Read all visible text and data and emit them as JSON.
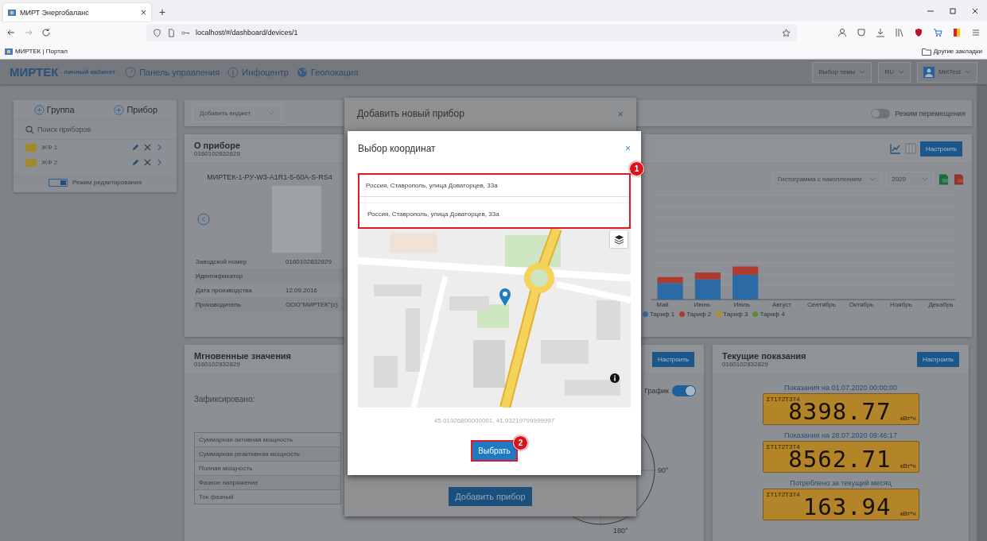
{
  "browser": {
    "tab": {
      "title": "МИРТ Энергобаланс",
      "close": "×"
    },
    "new_tab": "+",
    "url": "localhost/#/dashboard/devices/1",
    "bookmarks": [
      "МИРТЕК | Портал"
    ],
    "other_bookmarks": "Другие закладки"
  },
  "header": {
    "logo": "МИРТЕК",
    "logo_sub": "- личный кабинет",
    "nav": [
      {
        "label": "Панель управления",
        "kind": "gauge"
      },
      {
        "label": "Инфоцентр",
        "kind": "info"
      },
      {
        "label": "Геолокация",
        "kind": "globe"
      }
    ],
    "theme": "Выбор темы",
    "lang": "RU",
    "user": "MirtTest"
  },
  "sidebar": {
    "add_buttons": [
      "Группа",
      "Прибор"
    ],
    "search": {
      "placeholder": "Поиск приборов"
    },
    "groups": [
      {
        "name": "ЖФ 1"
      },
      {
        "name": "ЖФ 2"
      }
    ],
    "edit_mode": {
      "label": "Режим редактирования",
      "on": true
    }
  },
  "toolbar": {
    "widget_select": {
      "placeholder": "Добавить виджет"
    },
    "move_mode": {
      "label": "Режим перемещения",
      "on": false
    }
  },
  "device_card": {
    "title": "О приборе",
    "serial": "0160102832829",
    "model": "МИРТЕК-1-РУ-W3-A1R1-5-60A-S-RS4",
    "properties": [
      {
        "label": "Заводской номер",
        "value": "0160102832829"
      },
      {
        "label": "Идентификатор"
      },
      {
        "label": "Дата производства",
        "value": "12.09.2016"
      },
      {
        "label": "Производитель",
        "value": "ООО\"МИРТЕК\"(с)"
      }
    ]
  },
  "chart_widget": {
    "configure": "Настроить",
    "chart_type": "Гистограмма с накоплением",
    "year": "2020",
    "months": [
      "Май",
      "Июнь",
      "Июль",
      "Август",
      "Сентябрь",
      "Октябрь",
      "Ноябрь",
      "Декабрь"
    ],
    "legend": [
      {
        "label": "Тариф 1",
        "color": "#2c6aa6"
      },
      {
        "label": "Тариф 2",
        "color": "#b03a30"
      },
      {
        "label": "Тариф 3",
        "color": "#b58e1e"
      },
      {
        "label": "Тариф 4",
        "color": "#5f8a3c"
      }
    ]
  },
  "instant_card": {
    "title": "Мгновенные значения",
    "serial": "0160102832829",
    "configure": "Настроить",
    "recorded_label": "Зафиксировано:",
    "graph_toggle": {
      "label": "График",
      "on": true
    },
    "rows": [
      "Суммарная активная мощность",
      "Суммарная реактивная мощность",
      "Полная мощность",
      "Фазное напряжение",
      "Ток фазный"
    ],
    "angle_labels": [
      "90°",
      "180°"
    ]
  },
  "readings_card": {
    "title": "Текущие показания",
    "serial": "0160102832829",
    "configure": "Настроить",
    "readings": [
      {
        "caption": "Показания на 01.07.2020 00:00:00",
        "tariffs": "ΣT1T2T3T4",
        "value": "8398.77",
        "unit": "кВт*ч"
      },
      {
        "caption": "Показания на 28.07.2020 09:46:17",
        "tariffs": "ΣT1T2T3T4",
        "value": "8562.71",
        "unit": "кВт*ч"
      },
      {
        "caption": "Потреблено за текущий месяц",
        "tariffs": "ΣT1T2T3T4",
        "value": "163.94",
        "unit": "кВт*ч"
      }
    ]
  },
  "add_device_modal": {
    "title": "Добавить новый прибор",
    "close": "×",
    "submit": "Добавить прибор"
  },
  "coords_modal": {
    "title": "Выбор координат",
    "close": "×",
    "address": {
      "value": "Россия, Ставрополь, улица Доваторцев, 33а"
    },
    "suggestions": [
      "Россия, Ставрополь, улица Доваторцев, 33а"
    ],
    "coordinates": "45.01926800000001, 41.93219799999997",
    "select": "Выбрать",
    "callouts": [
      "1",
      "2"
    ]
  }
}
